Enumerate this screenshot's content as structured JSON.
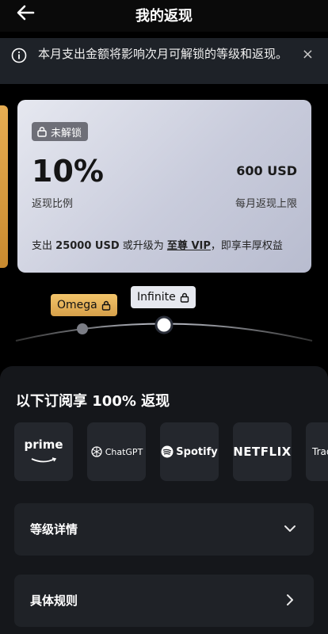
{
  "header": {
    "title": "我的返现",
    "back_icon": "arrow-left-icon"
  },
  "notice": {
    "text": "本月支出金额将影响次月可解锁的等级和返现。",
    "close": "×",
    "info_icon": "info-icon"
  },
  "card": {
    "badge": "未解锁",
    "rate": "10%",
    "rate_label": "返现比例",
    "limit": "600 USD",
    "limit_label": "每月返现上限",
    "upgrade_prefix": "支出",
    "upgrade_amount": "25000 USD",
    "upgrade_mid": "或升级为",
    "upgrade_link": "至尊 VIP",
    "upgrade_suffix": "，即享丰厚权益"
  },
  "tiers": {
    "omega": "Omega",
    "infinite": "Infinite"
  },
  "panel": {
    "title": "以下订阅享 100% 返现",
    "subscriptions": [
      "prime",
      "ChatGPT",
      "Spotify",
      "NETFLIX",
      "Trad"
    ],
    "rows": {
      "level_details": "等级详情",
      "rules": "具体规则"
    }
  },
  "colors": {
    "accent_gold": "#e0a84e",
    "background": "#000000",
    "panel": "#15171b"
  }
}
